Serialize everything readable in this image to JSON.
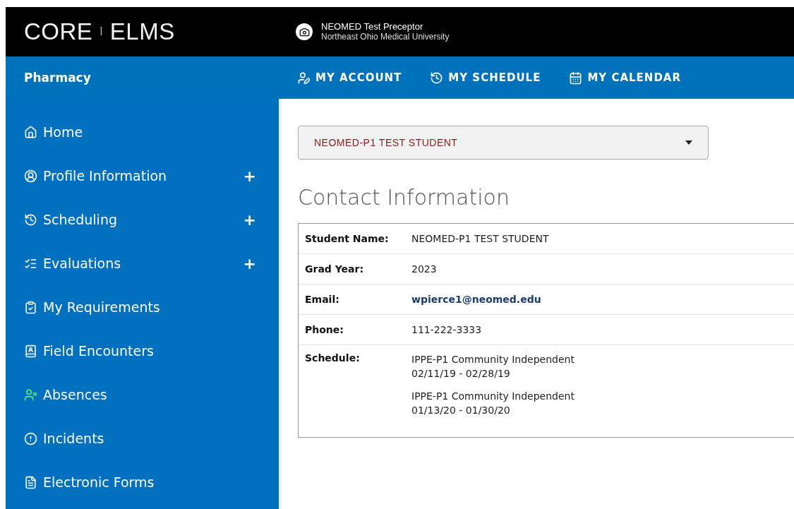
{
  "header": {
    "logo_left": "CORE",
    "logo_divider": "I",
    "logo_right": "ELMS",
    "user_name": "NEOMED Test Preceptor",
    "user_org": "Northeast Ohio Medical University"
  },
  "nav": {
    "section": "Pharmacy",
    "links": [
      {
        "label": "MY ACCOUNT"
      },
      {
        "label": "MY SCHEDULE"
      },
      {
        "label": "MY CALENDAR"
      }
    ]
  },
  "sidebar": {
    "items": [
      {
        "label": "Home"
      },
      {
        "label": "Profile Information",
        "toggle": "+"
      },
      {
        "label": "Scheduling",
        "toggle": "+"
      },
      {
        "label": "Evaluations",
        "toggle": "+"
      },
      {
        "label": "My Requirements"
      },
      {
        "label": "Field Encounters"
      },
      {
        "label": "Absences"
      },
      {
        "label": "Incidents"
      },
      {
        "label": "Electronic Forms"
      }
    ]
  },
  "student_select": {
    "value": "NEOMED-P1 TEST STUDENT"
  },
  "contact": {
    "title": "Contact Information",
    "rows": [
      {
        "label": "Student Name:",
        "kind": "text",
        "value": "NEOMED-P1 TEST STUDENT"
      },
      {
        "label": "Grad Year:",
        "kind": "text",
        "value": "2023"
      },
      {
        "label": "Email:",
        "kind": "link",
        "value": "wpierce1@neomed.edu"
      },
      {
        "label": "Phone:",
        "kind": "text",
        "value": "111-222-3333"
      },
      {
        "label": "Schedule:",
        "kind": "schedule",
        "entries": [
          {
            "course": "IPPE-P1 Community Independent",
            "dates": "02/11/19 - 02/28/19"
          },
          {
            "course": "IPPE-P1 Community Independent",
            "dates": "01/13/20 - 01/30/20"
          }
        ]
      }
    ]
  }
}
